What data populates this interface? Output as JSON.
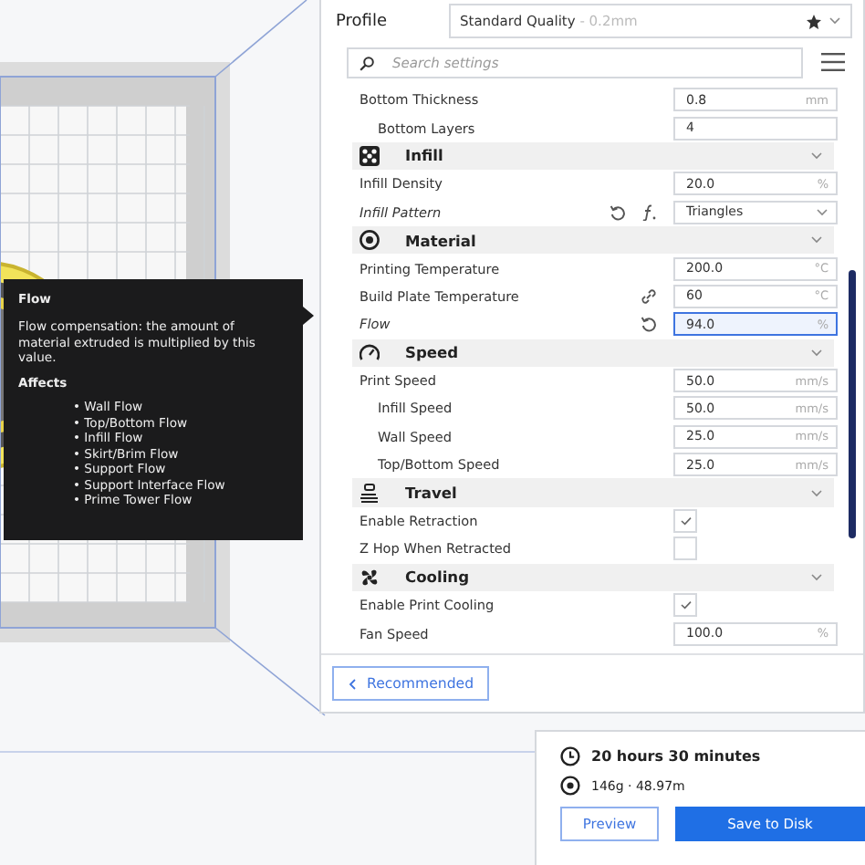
{
  "profile": {
    "label": "Profile",
    "value": "Standard Quality",
    "detail": " - 0.2mm"
  },
  "search": {
    "placeholder": "Search settings"
  },
  "settings": [
    {
      "kind": "value",
      "label": "Bottom Thickness",
      "value": "0.8",
      "unit": "mm",
      "children": [
        {
          "kind": "value",
          "label": "Bottom Layers",
          "value": "4"
        }
      ]
    },
    {
      "kind": "category",
      "label": "Infill",
      "expanded": true
    },
    {
      "kind": "value",
      "label": "Infill Density",
      "value": "20.0",
      "unit": "%"
    },
    {
      "kind": "dropdown",
      "label": "Infill Pattern",
      "value": "Triangles",
      "changed": true,
      "formula": true
    },
    {
      "kind": "category",
      "label": "Material",
      "expanded": true
    },
    {
      "kind": "value",
      "label": "Printing Temperature",
      "value": "200.0",
      "unit": "°C"
    },
    {
      "kind": "value",
      "label": "Build Plate Temperature",
      "value": "60",
      "unit": "°C",
      "linked": true
    },
    {
      "kind": "value",
      "label": "Flow",
      "value": "94.0",
      "unit": "%",
      "changed": true,
      "focused": true
    },
    {
      "kind": "category",
      "label": "Speed",
      "expanded": true
    },
    {
      "kind": "value",
      "label": "Print Speed",
      "value": "50.0",
      "unit": "mm/s",
      "children": [
        {
          "kind": "value",
          "label": "Infill Speed",
          "value": "50.0",
          "unit": "mm/s"
        },
        {
          "kind": "value",
          "label": "Wall Speed",
          "value": "25.0",
          "unit": "mm/s"
        },
        {
          "kind": "value",
          "label": "Top/Bottom Speed",
          "value": "25.0",
          "unit": "mm/s"
        }
      ]
    },
    {
      "kind": "category",
      "label": "Travel",
      "expanded": true
    },
    {
      "kind": "checkbox",
      "label": "Enable Retraction",
      "checked": true
    },
    {
      "kind": "checkbox",
      "label": "Z Hop When Retracted",
      "checked": false
    },
    {
      "kind": "category",
      "label": "Cooling",
      "expanded": true
    },
    {
      "kind": "checkbox",
      "label": "Enable Print Cooling",
      "checked": true
    },
    {
      "kind": "value",
      "label": "Fan Speed",
      "value": "100.0",
      "unit": "%"
    }
  ],
  "recommended_button": "Recommended",
  "tooltip": {
    "title": "Flow",
    "description": "Flow compensation: the amount of material extruded is multiplied by this value.",
    "affects_heading": "Affects",
    "affects": [
      "• Wall Flow",
      "• Top/Bottom Flow",
      "• Infill Flow",
      "• Skirt/Brim Flow",
      "• Support Flow",
      "• Support Interface Flow",
      "• Prime Tower Flow"
    ]
  },
  "print_info": {
    "time": "20 hours 30 minutes",
    "material": "146g · 48.97m"
  },
  "buttons": {
    "preview": "Preview",
    "save": "Save to Disk"
  }
}
